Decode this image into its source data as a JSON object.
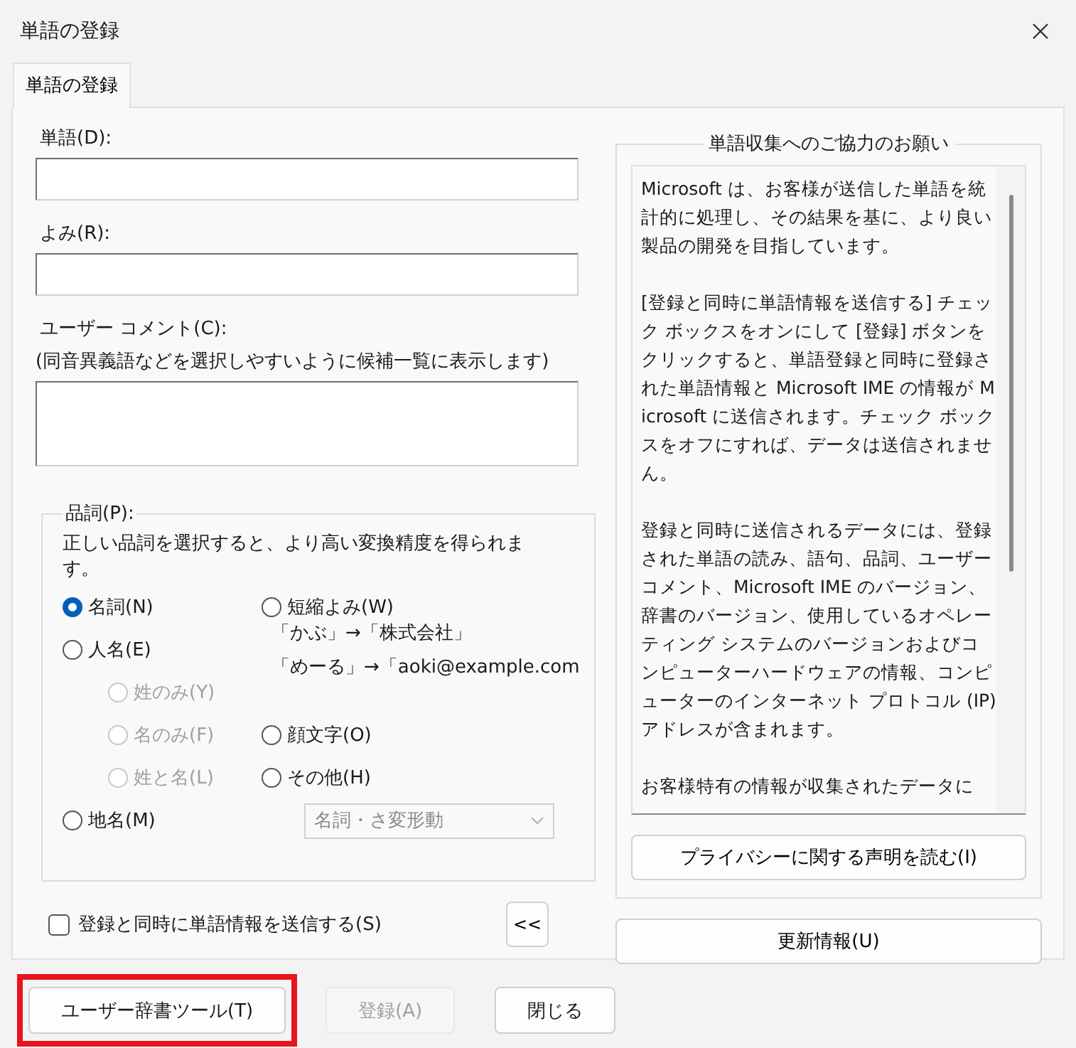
{
  "window": {
    "title": "単語の登録"
  },
  "tabs": [
    {
      "label": "単語の登録",
      "selected": true
    }
  ],
  "fields": [
    {
      "label": "単語(D):",
      "kind": "line"
    },
    {
      "label": "よみ(R):",
      "kind": "line"
    },
    {
      "label": "ユーザー コメント(C):",
      "hint": "(同音異義語などを選択しやすいように候補一覧に表示します)",
      "kind": "area"
    }
  ],
  "part_of_speech": {
    "title": "品詞(P):",
    "description": "正しい品詞を選択すると、より高い変換精度を得られます。",
    "left_options": [
      {
        "label": "名詞(N)",
        "selected": true,
        "disabled": false,
        "kind": "main"
      },
      {
        "label": "人名(E)",
        "selected": false,
        "disabled": false,
        "kind": "main"
      },
      {
        "label": "姓のみ(Y)",
        "selected": false,
        "disabled": true,
        "kind": "sub"
      },
      {
        "label": "名のみ(F)",
        "selected": false,
        "disabled": true,
        "kind": "sub"
      },
      {
        "label": "姓と名(L)",
        "selected": false,
        "disabled": true,
        "kind": "sub"
      },
      {
        "label": "地名(M)",
        "selected": false,
        "disabled": false,
        "kind": "main"
      }
    ],
    "right_options": [
      {
        "label": "短縮よみ(W)",
        "selected": false,
        "disabled": false
      },
      {
        "label": "顔文字(O)",
        "selected": false,
        "disabled": false
      },
      {
        "label": "その他(H)",
        "selected": false,
        "disabled": false
      }
    ],
    "examples": [
      "「かぶ」→「株式会社」",
      "「めーる」→「aoki@example.com"
    ],
    "dropdown": {
      "value": "名詞・さ変形動",
      "disabled": true
    }
  },
  "send_checkbox": {
    "label": "登録と同時に単語情報を送信する(S)",
    "checked": false
  },
  "collapse_button": "<<",
  "info_panel": {
    "title": "単語収集へのご協力のお願い",
    "paragraphs": [
      "Microsoft は、お客様が送信した単語を統計的に処理し、その結果を基に、より良い製品の開発を目指しています。",
      "[登録と同時に単語情報を送信する] チェック ボックスをオンにして [登録] ボタンをクリックすると、単語登録と同時に登録された単語情報と Microsoft IME の情報が Microsoft に送信されます。チェック ボックスをオフにすれば、データは送信されません。",
      "登録と同時に送信されるデータには、登録された単語の読み、語句、品詞、ユーザーコメント、Microsoft IME のバージョン、辞書のバージョン、使用しているオペレーティング システムのバージョンおよびコンピューターハードウェアの情報、コンピューターのインターネット プロトコル (IP) アドレスが含まれます。",
      "お客様特有の情報が収集されたデータに"
    ],
    "privacy_button": "プライバシーに関する声明を読む(I)"
  },
  "update_button": "更新情報(U)",
  "buttons": [
    {
      "label": "ユーザー辞書ツール(T)",
      "disabled": false,
      "highlighted": true
    },
    {
      "label": "登録(A)",
      "disabled": true,
      "highlighted": false
    },
    {
      "label": "閉じる",
      "disabled": false,
      "highlighted": false
    }
  ]
}
